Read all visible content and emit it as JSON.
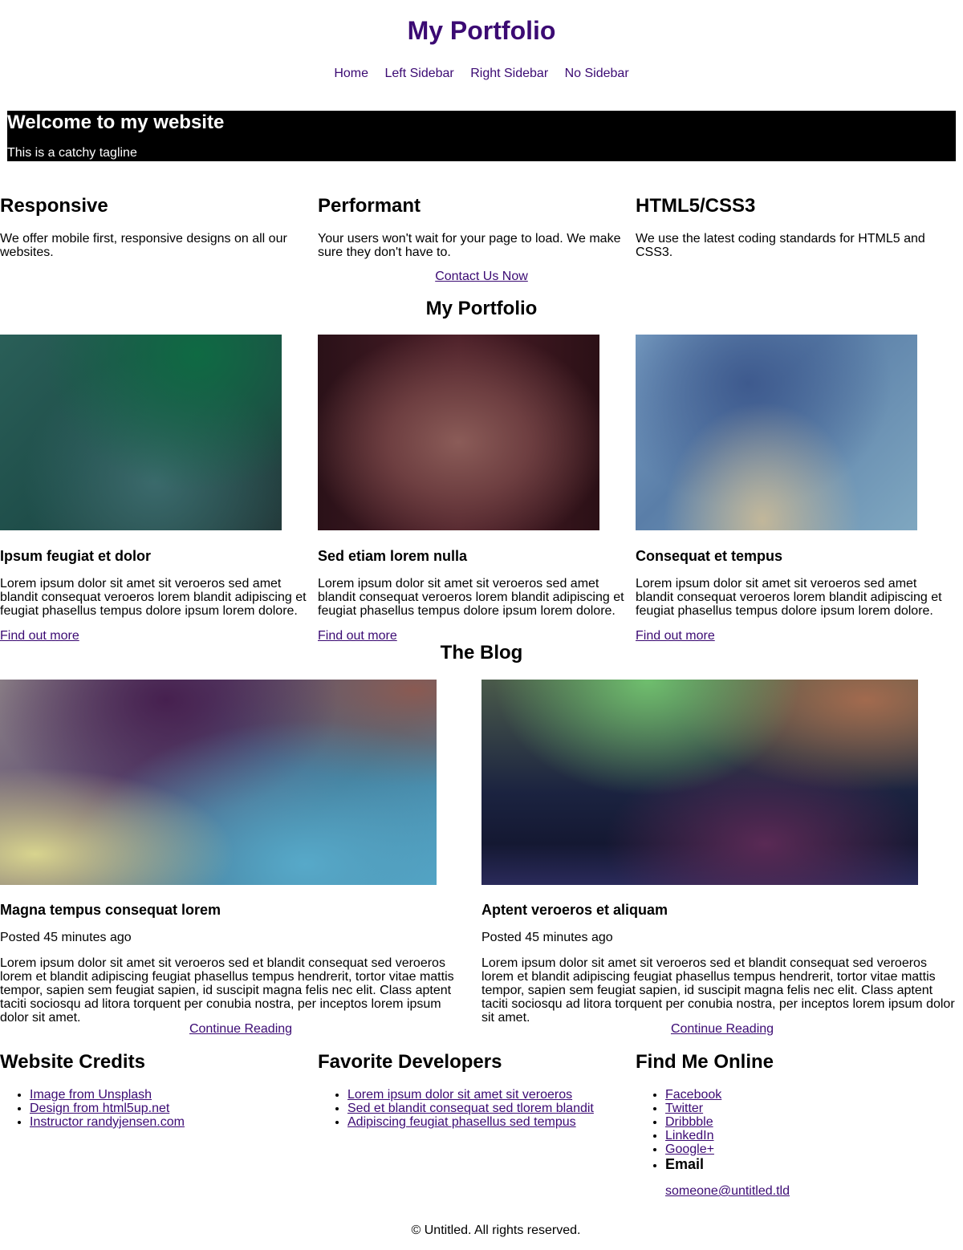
{
  "header": {
    "title": "My Portfolio",
    "nav": [
      "Home",
      "Left Sidebar",
      "Right Sidebar",
      "No Sidebar"
    ]
  },
  "banner": {
    "heading": "Welcome to my website",
    "tagline": "This is a catchy tagline"
  },
  "features": [
    {
      "title": "Responsive",
      "text": "We offer mobile first, responsive designs on all our websites."
    },
    {
      "title": "Performant",
      "text": "Your users won't wait for your page to load. We make sure they don't have to."
    },
    {
      "title": "HTML5/CSS3",
      "text": "We use the latest coding standards for HTML5 and CSS3."
    }
  ],
  "cta": {
    "label": "Contact Us Now"
  },
  "portfolio": {
    "heading": "My Portfolio",
    "items": [
      {
        "title": "Ipsum feugiat et dolor",
        "text": "Lorem ipsum dolor sit amet sit veroeros sed amet blandit consequat veroeros lorem blandit adipiscing et feugiat phasellus tempus dolore ipsum lorem dolore.",
        "link": "Find out more"
      },
      {
        "title": "Sed etiam lorem nulla",
        "text": "Lorem ipsum dolor sit amet sit veroeros sed amet blandit consequat veroeros lorem blandit adipiscing et feugiat phasellus tempus dolore ipsum lorem dolore.",
        "link": "Find out more"
      },
      {
        "title": "Consequat et tempus",
        "text": "Lorem ipsum dolor sit amet sit veroeros sed amet blandit consequat veroeros lorem blandit adipiscing et feugiat phasellus tempus dolore ipsum lorem dolore.",
        "link": "Find out more"
      }
    ]
  },
  "blog": {
    "heading": "The Blog",
    "posts": [
      {
        "title": "Magna tempus consequat lorem",
        "date": "Posted 45 minutes ago",
        "text": "Lorem ipsum dolor sit amet sit veroeros sed et blandit consequat sed veroeros lorem et blandit adipiscing feugiat phasellus tempus hendrerit, tortor vitae mattis tempor, sapien sem feugiat sapien, id suscipit magna felis nec elit. Class aptent taciti sociosqu ad litora torquent per conubia nostra, per inceptos lorem ipsum dolor sit amet.",
        "link": "Continue Reading"
      },
      {
        "title": "Aptent veroeros et aliquam",
        "date": "Posted 45 minutes ago",
        "text": "Lorem ipsum dolor sit amet sit veroeros sed et blandit consequat sed veroeros lorem et blandit adipiscing feugiat phasellus tempus hendrerit, tortor vitae mattis tempor, sapien sem feugiat sapien, id suscipit magna felis nec elit. Class aptent taciti sociosqu ad litora torquent per conubia nostra, per inceptos lorem ipsum dolor sit amet.",
        "link": "Continue Reading"
      }
    ]
  },
  "footer": {
    "credits": {
      "heading": "Website Credits",
      "links": [
        "Image from Unsplash",
        "Design from html5up.net",
        "Instructor randyjensen.com"
      ]
    },
    "developers": {
      "heading": "Favorite Developers",
      "links": [
        "Lorem ipsum dolor sit amet sit veroeros",
        "Sed et blandit consequat sed tlorem blandit",
        "Adipiscing feugiat phasellus sed tempus"
      ]
    },
    "online": {
      "heading": "Find Me Online",
      "links": [
        "Facebook",
        "Twitter",
        "Dribbble",
        "LinkedIn",
        "Google+"
      ],
      "email_label": "Email",
      "email": "someone@untitled.tld"
    },
    "copyright": "© Untitled. All rights reserved."
  },
  "colors": {
    "accent": "#3b0a73",
    "banner_bg": "#000000",
    "text": "#000000",
    "background": "#ffffff"
  }
}
